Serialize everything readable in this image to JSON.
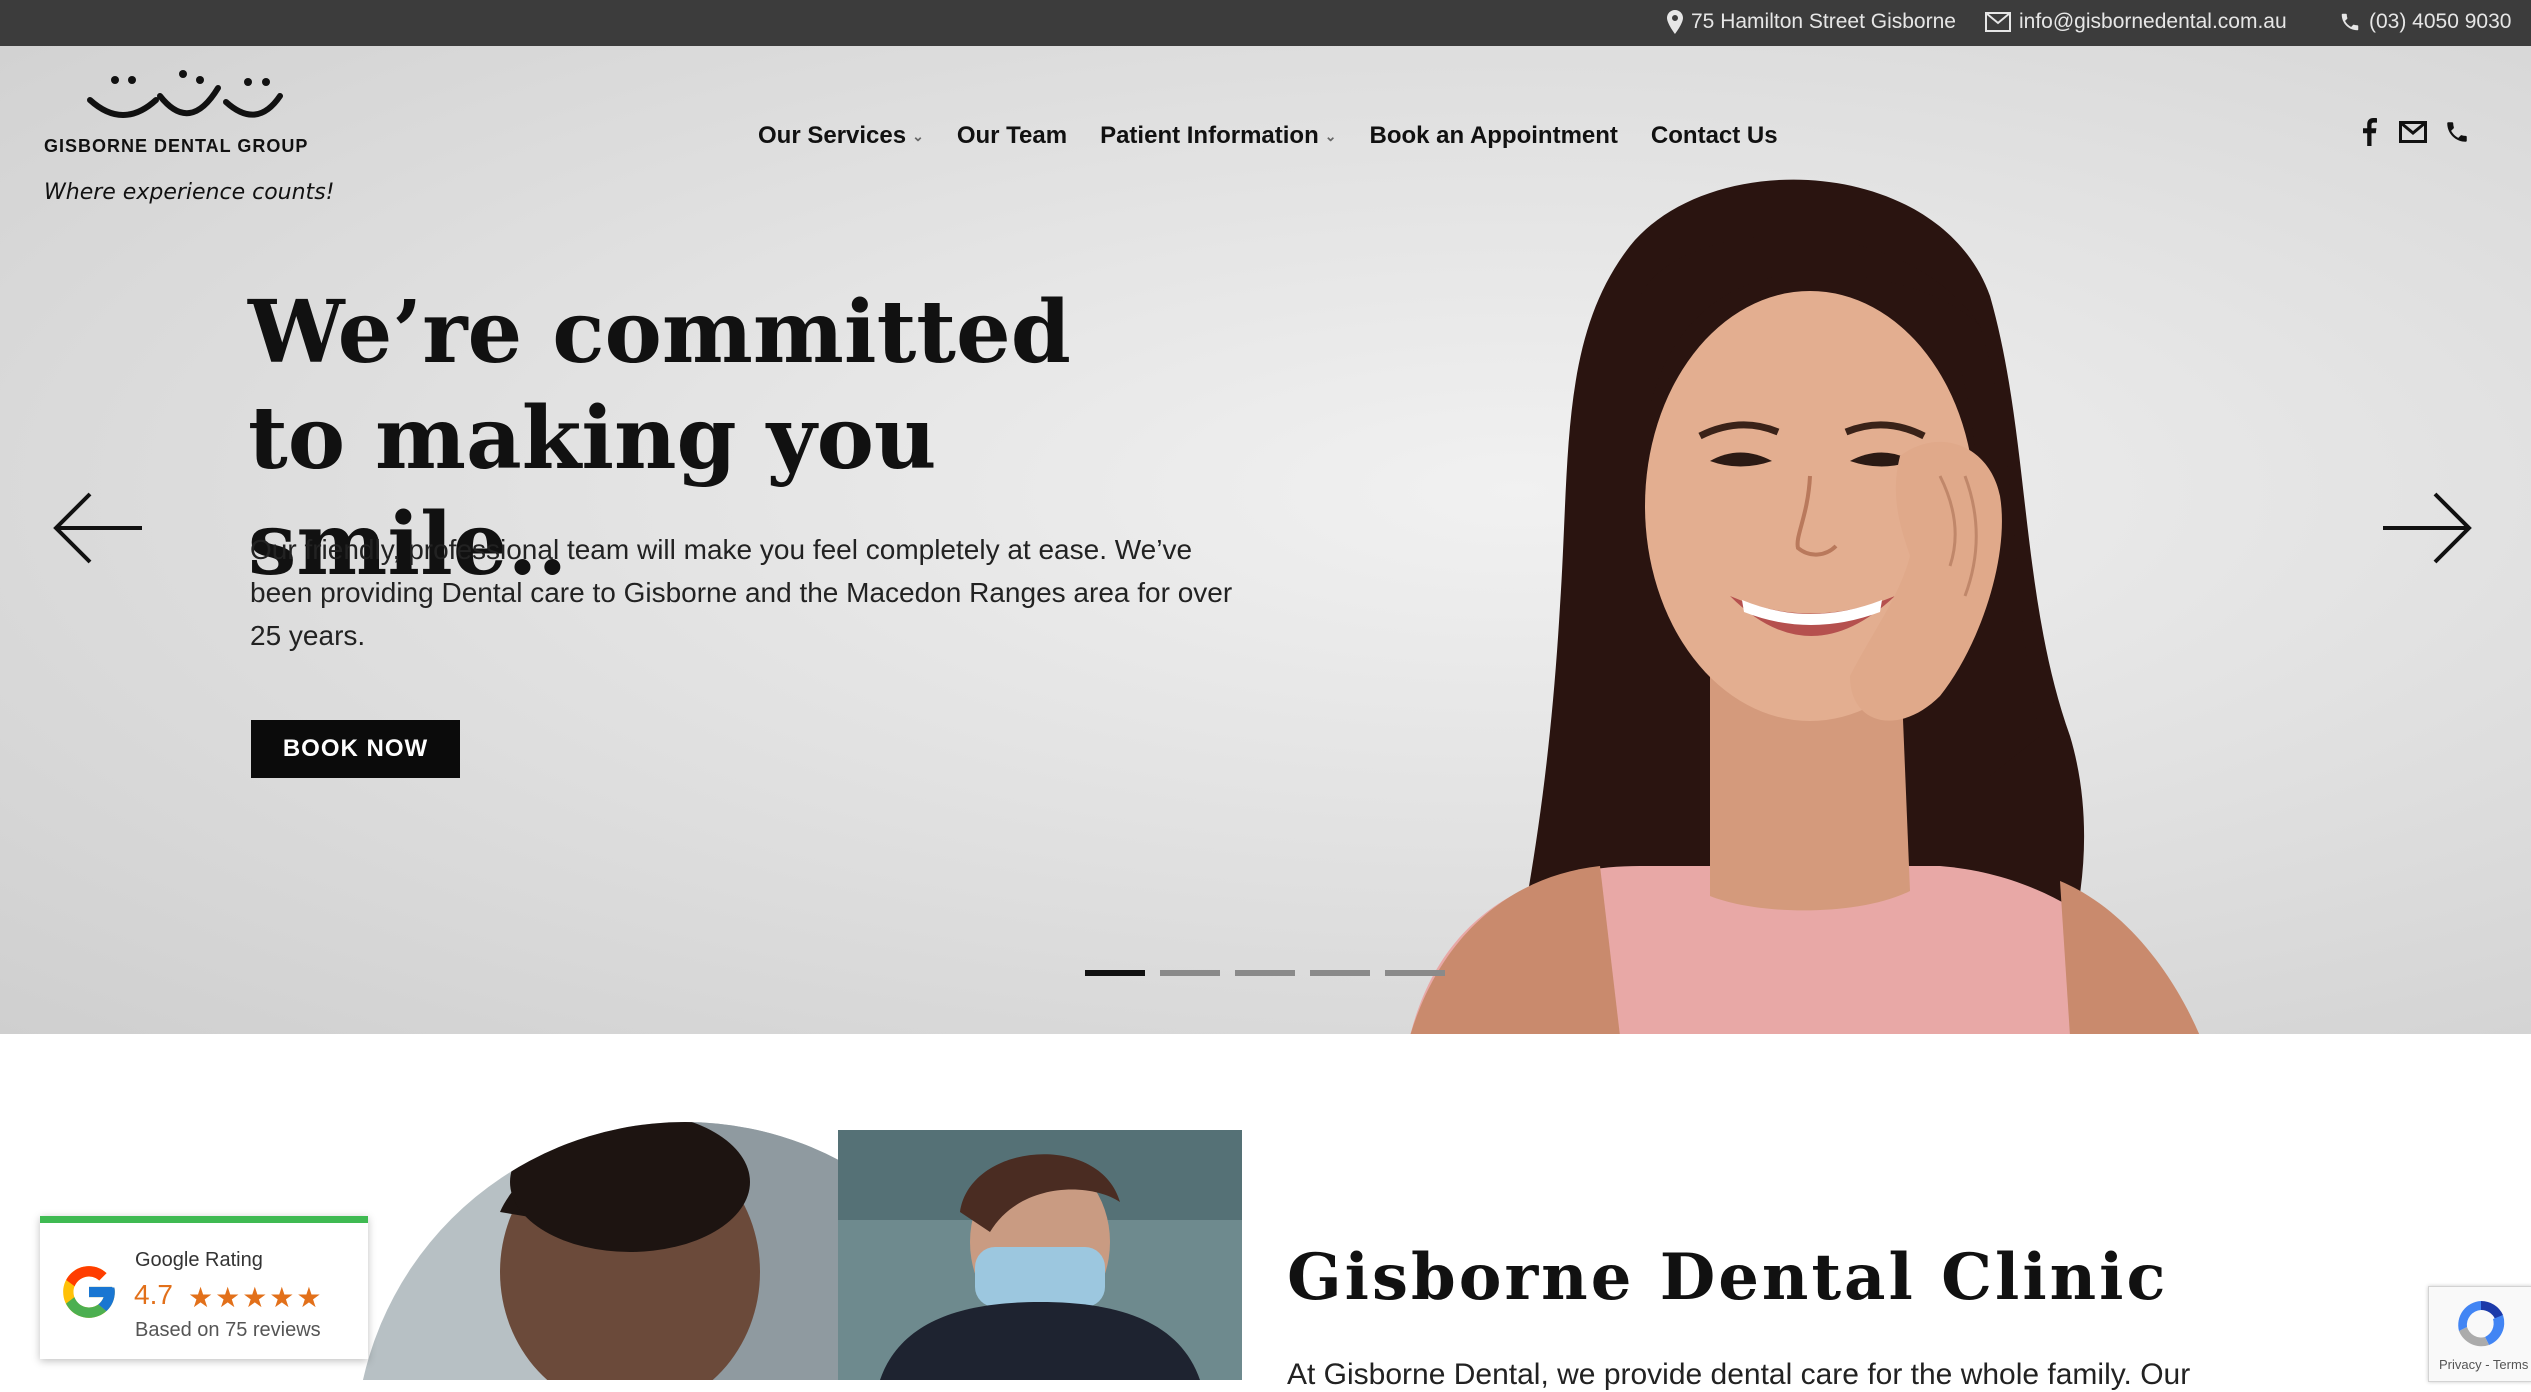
{
  "topbar": {
    "address": "75 Hamilton Street Gisborne",
    "email": "info@gisbornedental.com.au",
    "phone": "(03) 4050 9030"
  },
  "brand": {
    "name": "GISBORNE DENTAL GROUP",
    "tagline": "Where experience counts!"
  },
  "nav": {
    "items": [
      {
        "label": "Our Services",
        "dropdown": true
      },
      {
        "label": "Our Team",
        "dropdown": false
      },
      {
        "label": "Patient Information",
        "dropdown": true
      },
      {
        "label": "Book an Appointment",
        "dropdown": false
      },
      {
        "label": "Contact Us",
        "dropdown": false
      }
    ]
  },
  "social": {
    "icons": [
      "facebook-icon",
      "mail-icon",
      "phone-icon"
    ]
  },
  "hero": {
    "headline": "We’re committed to making you smile..",
    "body": "Our friendly, professional team will make you feel completely at ease. We’ve been providing Dental care to Gisborne and the Macedon Ranges area for over 25 years.",
    "cta": "BOOK NOW",
    "slides_total": 5,
    "active_slide": 1
  },
  "section": {
    "title": "Gisborne Dental Clinic",
    "intro": "At Gisborne Dental, we provide dental care for the whole family. Our"
  },
  "rating": {
    "label": "Google Rating",
    "score": "4.7",
    "stars": "★★★★★",
    "reviews": "Based on 75 reviews"
  },
  "recaptcha": {
    "text": "Privacy - Terms"
  },
  "colors": {
    "topbar": "#3c3c3c",
    "button": "#0b0b0b",
    "star": "#e2701a",
    "rating_bar": "#3fba52"
  }
}
